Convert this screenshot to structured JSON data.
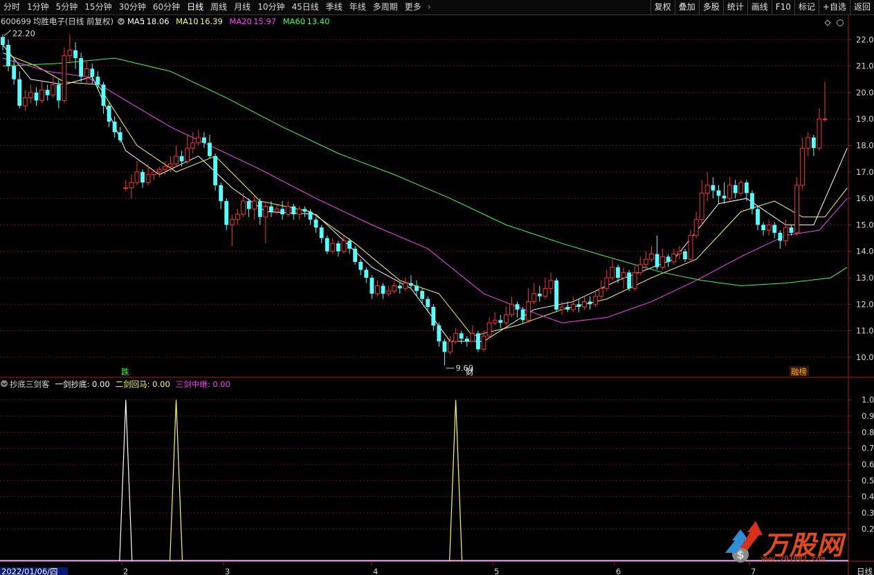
{
  "toolbar": {
    "periods": [
      "分时",
      "1分钟",
      "5分钟",
      "15分钟",
      "30分钟",
      "60分钟",
      "日线",
      "周线",
      "月线",
      "10分钟",
      "45日线",
      "季线",
      "年线",
      "多周期",
      "更多"
    ],
    "active_period": "日线",
    "more_arrow": "›",
    "right_tools": [
      "复权",
      "叠加",
      "多股",
      "统计",
      "画线",
      "F10",
      "标记",
      "+自选",
      "返回"
    ]
  },
  "main_chart": {
    "code": "600699",
    "name": "均胜电子",
    "period_info": "(日线 前复权)",
    "ma": [
      {
        "label": "MA5",
        "value": "18.06",
        "color": "#ffffff"
      },
      {
        "label": "MA10",
        "value": "16.39",
        "color": "#ffff40"
      },
      {
        "label": "MA20",
        "value": "15.97",
        "color": "#ff40ff"
      },
      {
        "label": "MA60",
        "value": "13.40",
        "color": "#40ff40"
      }
    ],
    "price_axis": [
      "22.0",
      "21.0",
      "20.0",
      "19.0",
      "18.0",
      "17.0",
      "16.0",
      "15.0",
      "14.0",
      "13.0",
      "12.0",
      "11.0",
      "10.0"
    ],
    "high_marker": "22.20",
    "low_marker": "9.69",
    "events": [
      {
        "text": "跌",
        "color": "#40ff40"
      },
      {
        "text": "财",
        "color": "#ffffff"
      },
      {
        "text": "融榜",
        "color": "#ffb020"
      }
    ]
  },
  "indicator": {
    "name": "抄底三剑客",
    "lines": [
      {
        "label": "一剑抄底",
        "value": "0.00",
        "color": "#ffffff"
      },
      {
        "label": "二剑回马",
        "value": "0.00",
        "color": "#ffff40"
      },
      {
        "label": "三剑中继",
        "value": "0.00",
        "color": "#ff40ff"
      }
    ],
    "axis": [
      "1.0",
      "0.9",
      "0.8",
      "0.7",
      "0.6",
      "0.5",
      "0.4",
      "0.3",
      "0.2"
    ]
  },
  "time_axis": {
    "cursor_date": "2022/01/06/四",
    "months": [
      "2",
      "3",
      "4",
      "5",
      "6",
      "7"
    ],
    "period_label": "日线"
  },
  "watermark": {
    "text": "万股网",
    "url": "www.201082.com"
  },
  "chart_data": {
    "type": "candlestick",
    "ylim": [
      9.5,
      22.4
    ],
    "candles": [
      [
        22.1,
        21.8,
        22.2,
        21.6
      ],
      [
        21.8,
        21.0,
        22.0,
        20.8
      ],
      [
        21.0,
        20.5,
        21.3,
        20.3
      ],
      [
        20.5,
        19.5,
        20.8,
        19.4
      ],
      [
        19.5,
        19.8,
        20.1,
        19.3
      ],
      [
        19.8,
        20.0,
        20.3,
        19.6
      ],
      [
        20.0,
        19.7,
        20.2,
        19.5
      ],
      [
        19.7,
        20.1,
        20.4,
        19.6
      ],
      [
        20.1,
        19.9,
        20.3,
        19.7
      ],
      [
        19.9,
        20.3,
        20.6,
        19.8
      ],
      [
        20.3,
        19.7,
        20.5,
        19.4
      ],
      [
        19.7,
        21.4,
        21.7,
        19.6
      ],
      [
        21.4,
        21.6,
        22.2,
        21.1
      ],
      [
        21.6,
        21.3,
        21.9,
        20.9
      ],
      [
        21.3,
        20.6,
        21.5,
        20.4
      ],
      [
        20.6,
        20.9,
        21.2,
        20.3
      ],
      [
        20.9,
        20.6,
        21.1,
        20.3
      ],
      [
        20.6,
        20.3,
        20.8,
        20.1
      ],
      [
        20.3,
        19.5,
        20.4,
        19.2
      ],
      [
        19.5,
        18.9,
        19.6,
        18.7
      ],
      [
        18.9,
        18.5,
        19.1,
        18.3
      ],
      [
        18.5,
        18.2,
        18.7,
        18.1
      ],
      [
        16.4,
        16.4,
        16.7,
        16.3
      ],
      [
        16.4,
        16.6,
        16.9,
        16.0
      ],
      [
        16.6,
        17.0,
        17.4,
        16.5
      ],
      [
        17.0,
        16.6,
        17.1,
        16.4
      ],
      [
        16.6,
        16.9,
        17.3,
        16.5
      ],
      [
        16.9,
        17.0,
        17.1,
        16.7
      ],
      [
        17.0,
        17.1,
        17.2,
        16.8
      ],
      [
        17.1,
        17.2,
        17.4,
        16.9
      ],
      [
        17.2,
        17.3,
        17.6,
        17.0
      ],
      [
        17.3,
        17.6,
        18.0,
        17.2
      ],
      [
        17.6,
        17.4,
        17.8,
        17.2
      ],
      [
        17.4,
        17.9,
        18.4,
        17.3
      ],
      [
        17.9,
        18.1,
        18.5,
        17.7
      ],
      [
        18.1,
        18.3,
        18.6,
        18.0
      ],
      [
        18.3,
        18.1,
        18.5,
        17.9
      ],
      [
        18.1,
        17.6,
        18.4,
        17.5
      ],
      [
        17.6,
        16.5,
        17.7,
        16.3
      ],
      [
        16.5,
        15.9,
        16.6,
        15.6
      ],
      [
        15.9,
        15.0,
        16.0,
        14.8
      ],
      [
        15.0,
        15.2,
        15.4,
        14.2
      ],
      [
        15.2,
        15.4,
        15.6,
        15.0
      ],
      [
        15.4,
        15.9,
        16.2,
        15.3
      ],
      [
        15.9,
        15.6,
        16.0,
        15.3
      ],
      [
        15.6,
        15.9,
        16.1,
        15.2
      ],
      [
        15.9,
        15.3,
        16.0,
        15.0
      ],
      [
        15.3,
        15.7,
        15.9,
        14.3
      ],
      [
        15.7,
        15.5,
        15.9,
        15.3
      ],
      [
        15.5,
        15.6,
        15.8,
        15.4
      ],
      [
        15.6,
        15.4,
        15.9,
        15.2
      ],
      [
        15.4,
        15.7,
        15.9,
        15.3
      ],
      [
        15.7,
        15.4,
        15.8,
        15.2
      ],
      [
        15.4,
        15.6,
        15.7,
        15.2
      ],
      [
        15.6,
        15.5,
        15.7,
        15.3
      ],
      [
        15.5,
        15.2,
        15.6,
        15.0
      ],
      [
        15.2,
        14.9,
        15.3,
        14.7
      ],
      [
        14.9,
        14.5,
        15.0,
        14.3
      ],
      [
        14.5,
        14.0,
        14.6,
        13.9
      ],
      [
        14.0,
        14.3,
        14.5,
        13.9
      ],
      [
        14.3,
        14.0,
        14.4,
        13.8
      ],
      [
        14.0,
        14.4,
        14.6,
        13.9
      ],
      [
        14.4,
        14.1,
        14.5,
        13.9
      ],
      [
        14.1,
        13.6,
        14.2,
        13.5
      ],
      [
        13.6,
        13.3,
        13.7,
        13.1
      ],
      [
        13.3,
        13.0,
        13.4,
        12.8
      ],
      [
        13.0,
        12.4,
        13.1,
        12.2
      ],
      [
        12.4,
        12.7,
        12.9,
        12.3
      ],
      [
        12.7,
        12.4,
        12.8,
        12.2
      ],
      [
        12.4,
        12.5,
        12.7,
        12.3
      ],
      [
        12.5,
        12.7,
        12.9,
        12.4
      ],
      [
        12.7,
        12.6,
        12.8,
        12.4
      ],
      [
        12.6,
        12.8,
        13.0,
        12.5
      ],
      [
        12.8,
        12.7,
        13.1,
        12.6
      ],
      [
        12.7,
        12.5,
        12.9,
        12.3
      ],
      [
        12.5,
        12.2,
        12.6,
        12.0
      ],
      [
        12.2,
        11.9,
        12.3,
        11.7
      ],
      [
        11.9,
        11.2,
        12.0,
        11.0
      ],
      [
        11.2,
        10.6,
        11.3,
        10.4
      ],
      [
        10.6,
        10.2,
        10.7,
        9.69
      ],
      [
        10.2,
        10.6,
        10.8,
        10.1
      ],
      [
        10.6,
        10.9,
        11.1,
        10.5
      ],
      [
        10.9,
        10.7,
        11.0,
        10.5
      ],
      [
        10.7,
        10.6,
        10.8,
        10.4
      ],
      [
        10.6,
        10.9,
        11.2,
        10.6
      ],
      [
        10.9,
        10.3,
        11.0,
        10.2
      ],
      [
        10.3,
        10.8,
        11.0,
        10.2
      ],
      [
        10.8,
        11.3,
        11.5,
        10.7
      ],
      [
        11.3,
        11.4,
        11.7,
        11.2
      ],
      [
        11.4,
        11.3,
        11.6,
        11.1
      ],
      [
        11.3,
        11.6,
        11.9,
        11.2
      ],
      [
        11.6,
        12.0,
        12.3,
        11.5
      ],
      [
        12.0,
        11.8,
        12.1,
        11.5
      ],
      [
        11.8,
        11.4,
        11.9,
        11.3
      ],
      [
        11.4,
        12.1,
        12.6,
        11.3
      ],
      [
        12.1,
        12.4,
        12.8,
        12.0
      ],
      [
        12.4,
        12.3,
        12.7,
        12.1
      ],
      [
        12.3,
        12.6,
        13.0,
        12.2
      ],
      [
        12.6,
        12.9,
        13.2,
        12.4
      ],
      [
        12.9,
        11.8,
        13.0,
        11.7
      ],
      [
        11.8,
        11.9,
        12.1,
        11.6
      ],
      [
        11.9,
        11.8,
        12.1,
        11.7
      ],
      [
        11.8,
        12.0,
        12.3,
        11.7
      ],
      [
        12.0,
        11.9,
        12.2,
        11.7
      ],
      [
        11.9,
        12.1,
        12.3,
        11.8
      ],
      [
        12.1,
        12.0,
        12.3,
        11.8
      ],
      [
        12.0,
        12.3,
        12.5,
        11.9
      ],
      [
        12.3,
        12.6,
        12.9,
        12.2
      ],
      [
        12.6,
        13.0,
        13.3,
        12.5
      ],
      [
        13.0,
        13.4,
        13.7,
        12.9
      ],
      [
        13.4,
        13.0,
        13.5,
        12.8
      ],
      [
        13.0,
        13.2,
        13.4,
        12.6
      ],
      [
        13.2,
        12.6,
        13.3,
        12.5
      ],
      [
        12.6,
        13.2,
        13.5,
        12.5
      ],
      [
        13.2,
        13.5,
        13.8,
        13.1
      ],
      [
        13.5,
        13.7,
        14.0,
        13.3
      ],
      [
        13.7,
        13.9,
        14.2,
        13.6
      ],
      [
        13.9,
        13.4,
        14.6,
        13.3
      ],
      [
        13.4,
        13.8,
        14.1,
        13.3
      ],
      [
        13.8,
        13.6,
        13.9,
        13.4
      ],
      [
        13.6,
        13.9,
        14.1,
        13.5
      ],
      [
        13.9,
        14.0,
        14.2,
        13.7
      ],
      [
        14.0,
        13.7,
        14.1,
        13.6
      ],
      [
        13.7,
        14.6,
        14.8,
        13.6
      ],
      [
        14.6,
        15.2,
        15.5,
        14.5
      ],
      [
        15.2,
        16.2,
        16.7,
        15.0
      ],
      [
        16.2,
        16.5,
        17.0,
        15.9
      ],
      [
        16.5,
        16.3,
        16.8,
        16.0
      ],
      [
        16.3,
        16.1,
        16.5,
        15.8
      ],
      [
        16.1,
        16.0,
        16.6,
        15.8
      ],
      [
        16.0,
        16.5,
        16.8,
        15.9
      ],
      [
        16.5,
        16.2,
        16.7,
        16.0
      ],
      [
        16.2,
        16.6,
        16.7,
        16.1
      ],
      [
        16.6,
        16.2,
        16.7,
        15.9
      ],
      [
        16.2,
        15.6,
        16.3,
        15.4
      ],
      [
        15.6,
        15.0,
        15.7,
        14.8
      ],
      [
        15.0,
        14.8,
        15.1,
        14.6
      ],
      [
        14.8,
        15.0,
        15.2,
        14.6
      ],
      [
        15.0,
        14.7,
        15.1,
        14.5
      ],
      [
        14.7,
        14.4,
        14.8,
        14.1
      ],
      [
        14.4,
        14.9,
        15.2,
        14.2
      ],
      [
        14.9,
        14.7,
        15.0,
        14.6
      ],
      [
        14.7,
        16.5,
        16.8,
        14.6
      ],
      [
        16.5,
        17.9,
        18.3,
        16.3
      ],
      [
        17.9,
        18.3,
        18.5,
        17.6
      ],
      [
        18.3,
        17.9,
        18.4,
        17.6
      ],
      [
        17.9,
        19.0,
        19.4,
        17.8
      ],
      [
        19.0,
        19.0,
        20.4,
        18.9
      ]
    ],
    "ma": [
      {
        "name": "MA5",
        "color": "#ffffff",
        "points": [
          [
            0,
            21.8
          ],
          [
            5,
            20.5
          ],
          [
            11,
            20.3
          ],
          [
            16,
            20.6
          ],
          [
            22,
            17.8
          ],
          [
            28,
            16.9
          ],
          [
            35,
            17.6
          ],
          [
            41,
            16.4
          ],
          [
            47,
            15.5
          ],
          [
            56,
            15.4
          ],
          [
            66,
            13.4
          ],
          [
            73,
            12.6
          ],
          [
            80,
            10.6
          ],
          [
            86,
            10.6
          ],
          [
            95,
            11.8
          ],
          [
            102,
            12.1
          ],
          [
            110,
            12.9
          ],
          [
            120,
            13.7
          ],
          [
            128,
            15.8
          ],
          [
            133,
            16.0
          ],
          [
            140,
            15.0
          ],
          [
            145,
            15.0
          ],
          [
            151,
            17.9
          ]
        ]
      },
      {
        "name": "MA10",
        "color": "#ffff40",
        "points": [
          [
            0,
            21.5
          ],
          [
            6,
            21.0
          ],
          [
            11,
            20.4
          ],
          [
            17,
            20.3
          ],
          [
            24,
            18.0
          ],
          [
            31,
            17.0
          ],
          [
            38,
            17.6
          ],
          [
            46,
            15.9
          ],
          [
            55,
            15.5
          ],
          [
            63,
            14.3
          ],
          [
            71,
            12.9
          ],
          [
            78,
            12.4
          ],
          [
            84,
            10.8
          ],
          [
            92,
            11.2
          ],
          [
            100,
            11.8
          ],
          [
            108,
            12.2
          ],
          [
            116,
            13.0
          ],
          [
            124,
            13.7
          ],
          [
            132,
            15.5
          ],
          [
            138,
            15.9
          ],
          [
            143,
            15.3
          ],
          [
            147,
            15.3
          ],
          [
            151,
            16.4
          ]
        ]
      },
      {
        "name": "MA20",
        "color": "#ff40ff",
        "points": [
          [
            0,
            21.3
          ],
          [
            8,
            20.8
          ],
          [
            15,
            20.6
          ],
          [
            22,
            19.7
          ],
          [
            30,
            18.7
          ],
          [
            38,
            17.9
          ],
          [
            46,
            17.1
          ],
          [
            56,
            16.0
          ],
          [
            66,
            15.0
          ],
          [
            76,
            14.1
          ],
          [
            86,
            12.4
          ],
          [
            92,
            11.9
          ],
          [
            100,
            11.3
          ],
          [
            108,
            11.5
          ],
          [
            116,
            12.1
          ],
          [
            124,
            12.9
          ],
          [
            132,
            13.8
          ],
          [
            140,
            14.6
          ],
          [
            146,
            14.8
          ],
          [
            151,
            16.0
          ]
        ]
      },
      {
        "name": "MA60",
        "color": "#40ff40",
        "points": [
          [
            0,
            21.0
          ],
          [
            10,
            21.1
          ],
          [
            20,
            21.3
          ],
          [
            30,
            20.8
          ],
          [
            40,
            19.8
          ],
          [
            50,
            18.7
          ],
          [
            60,
            17.7
          ],
          [
            70,
            16.9
          ],
          [
            80,
            16.0
          ],
          [
            90,
            15.0
          ],
          [
            100,
            14.3
          ],
          [
            108,
            13.8
          ],
          [
            118,
            13.2
          ],
          [
            125,
            12.9
          ],
          [
            132,
            12.7
          ],
          [
            140,
            12.8
          ],
          [
            148,
            13.0
          ],
          [
            151,
            13.4
          ]
        ]
      }
    ],
    "indicator_spikes": [
      {
        "index": 22,
        "line": "一剑抄底",
        "value": 1.0,
        "color": "#ffffff"
      },
      {
        "index": 31,
        "line": "二剑回马",
        "value": 1.0,
        "color": "#ffff40"
      },
      {
        "index": 81,
        "line": "二剑回马",
        "value": 1.0,
        "color": "#ffff40"
      }
    ],
    "indicator_ylim": [
      0,
      1.05
    ]
  }
}
